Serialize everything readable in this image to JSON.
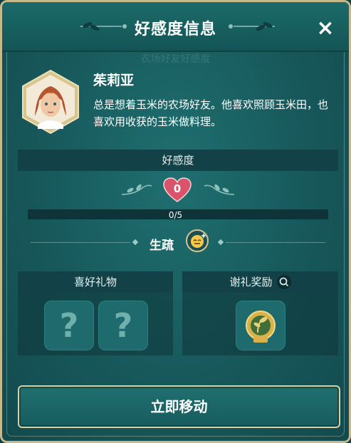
{
  "window": {
    "title": "好感度信息",
    "close_icon": "×",
    "watermark": "农场好友好感度"
  },
  "npc": {
    "name": "茱莉亚",
    "description": "总是想着玉米的农场好友。他喜欢照顾玉米田，也喜欢用收获的玉米做料理。",
    "avatar_icon": "npc-portrait"
  },
  "affection": {
    "label": "好感度",
    "level": "0",
    "progress_text": "0/5",
    "progress_fraction": 0,
    "relationship": "生疏",
    "heart_color": "#d9536a"
  },
  "gifts": {
    "label": "喜好礼物",
    "slots": [
      "?",
      "?"
    ]
  },
  "rewards": {
    "label": "谢礼奖励",
    "item_icon": "golden-seed-icon"
  },
  "actions": {
    "move_label": "立即移动"
  },
  "colors": {
    "accent_gold": "#c7b98b",
    "panel_teal": "#17585b",
    "bar_dark": "#124248"
  }
}
